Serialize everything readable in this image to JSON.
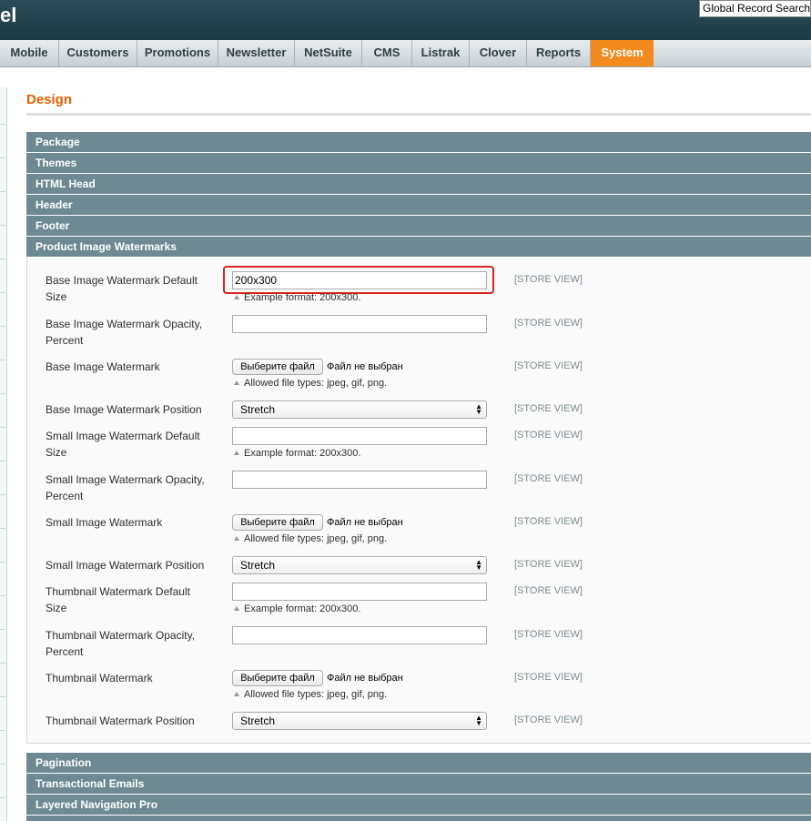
{
  "header": {
    "brand": "el",
    "search_label": "Global Record Search"
  },
  "nav": {
    "items": [
      "Mobile",
      "Customers",
      "Promotions",
      "Newsletter",
      "NetSuite",
      "CMS",
      "Listrak",
      "Clover",
      "Reports",
      "System"
    ],
    "active": "System"
  },
  "page": {
    "title": "Design"
  },
  "sections_top": [
    "Package",
    "Themes",
    "HTML Head",
    "Header",
    "Footer",
    "Product Image Watermarks"
  ],
  "sections_bottom": [
    "Pagination",
    "Transactional Emails",
    "Layered Navigation Pro"
  ],
  "scope_label": "[STORE VIEW]",
  "format_note": "Example format: 200x300.",
  "filetypes_note": "Allowed file types: jpeg, gif, png.",
  "file_button": "Выберите файл",
  "file_none": "Файл не выбран",
  "fields": {
    "base_size": {
      "label_1": "Base Image Watermark Default",
      "label_2": "Size",
      "value": "200x300"
    },
    "base_opacity": {
      "label_1": "Base Image Watermark Opacity,",
      "label_2": "Percent",
      "value": ""
    },
    "base_image": {
      "label_1": "Base Image Watermark"
    },
    "base_position": {
      "label_1": "Base Image Watermark Position",
      "value": "Stretch"
    },
    "small_size": {
      "label_1": "Small Image Watermark Default",
      "label_2": "Size",
      "value": ""
    },
    "small_opacity": {
      "label_1": "Small Image Watermark Opacity,",
      "label_2": "Percent",
      "value": ""
    },
    "small_image": {
      "label_1": "Small Image Watermark"
    },
    "small_position": {
      "label_1": "Small Image Watermark Position",
      "value": "Stretch"
    },
    "thumb_size": {
      "label_1": "Thumbnail Watermark Default",
      "label_2": "Size",
      "value": ""
    },
    "thumb_opacity": {
      "label_1": "Thumbnail Watermark Opacity,",
      "label_2": "Percent",
      "value": ""
    },
    "thumb_image": {
      "label_1": "Thumbnail Watermark"
    },
    "thumb_position": {
      "label_1": "Thumbnail Watermark Position",
      "value": "Stretch"
    }
  }
}
